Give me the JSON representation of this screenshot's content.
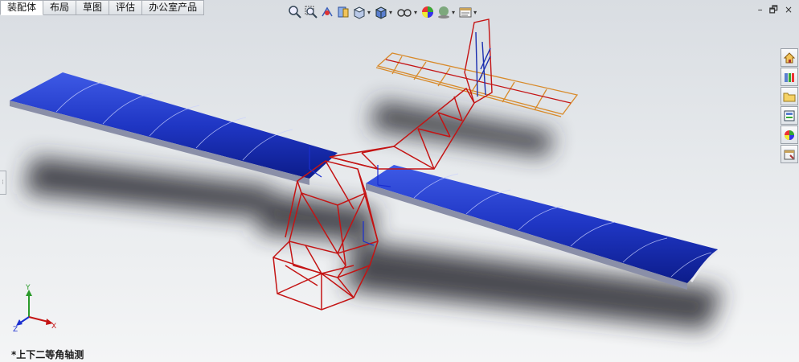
{
  "tabs": [
    {
      "label": "装配体",
      "active": true
    },
    {
      "label": "布局",
      "active": false
    },
    {
      "label": "草图",
      "active": false
    },
    {
      "label": "评估",
      "active": false
    },
    {
      "label": "办公室产品",
      "active": false
    }
  ],
  "hud_toolbar": [
    "zoom-to-fit-icon",
    "zoom-area-icon",
    "previous-view-icon",
    "section-view-icon",
    "view-orientation-icon",
    "display-style-icon",
    "hide-show-items-icon",
    "edit-appearance-icon",
    "apply-scene-icon",
    "view-settings-icon"
  ],
  "window_controls": {
    "minimize": "–",
    "restore": "🗗",
    "close": "×"
  },
  "task_pane": [
    "solidworks-resources-icon",
    "design-library-icon",
    "file-explorer-icon",
    "view-palette-icon",
    "appearances-scenes-icon",
    "custom-properties-icon"
  ],
  "collapse_handle": "⋮",
  "view_name": "*上下二等角轴测",
  "triad": {
    "x": "X",
    "y": "Y",
    "z": "Z"
  },
  "colors": {
    "wing": "#1f36c4",
    "frame": "#c41414",
    "tail": "#d88a2a",
    "background": "#e3e6e9"
  }
}
